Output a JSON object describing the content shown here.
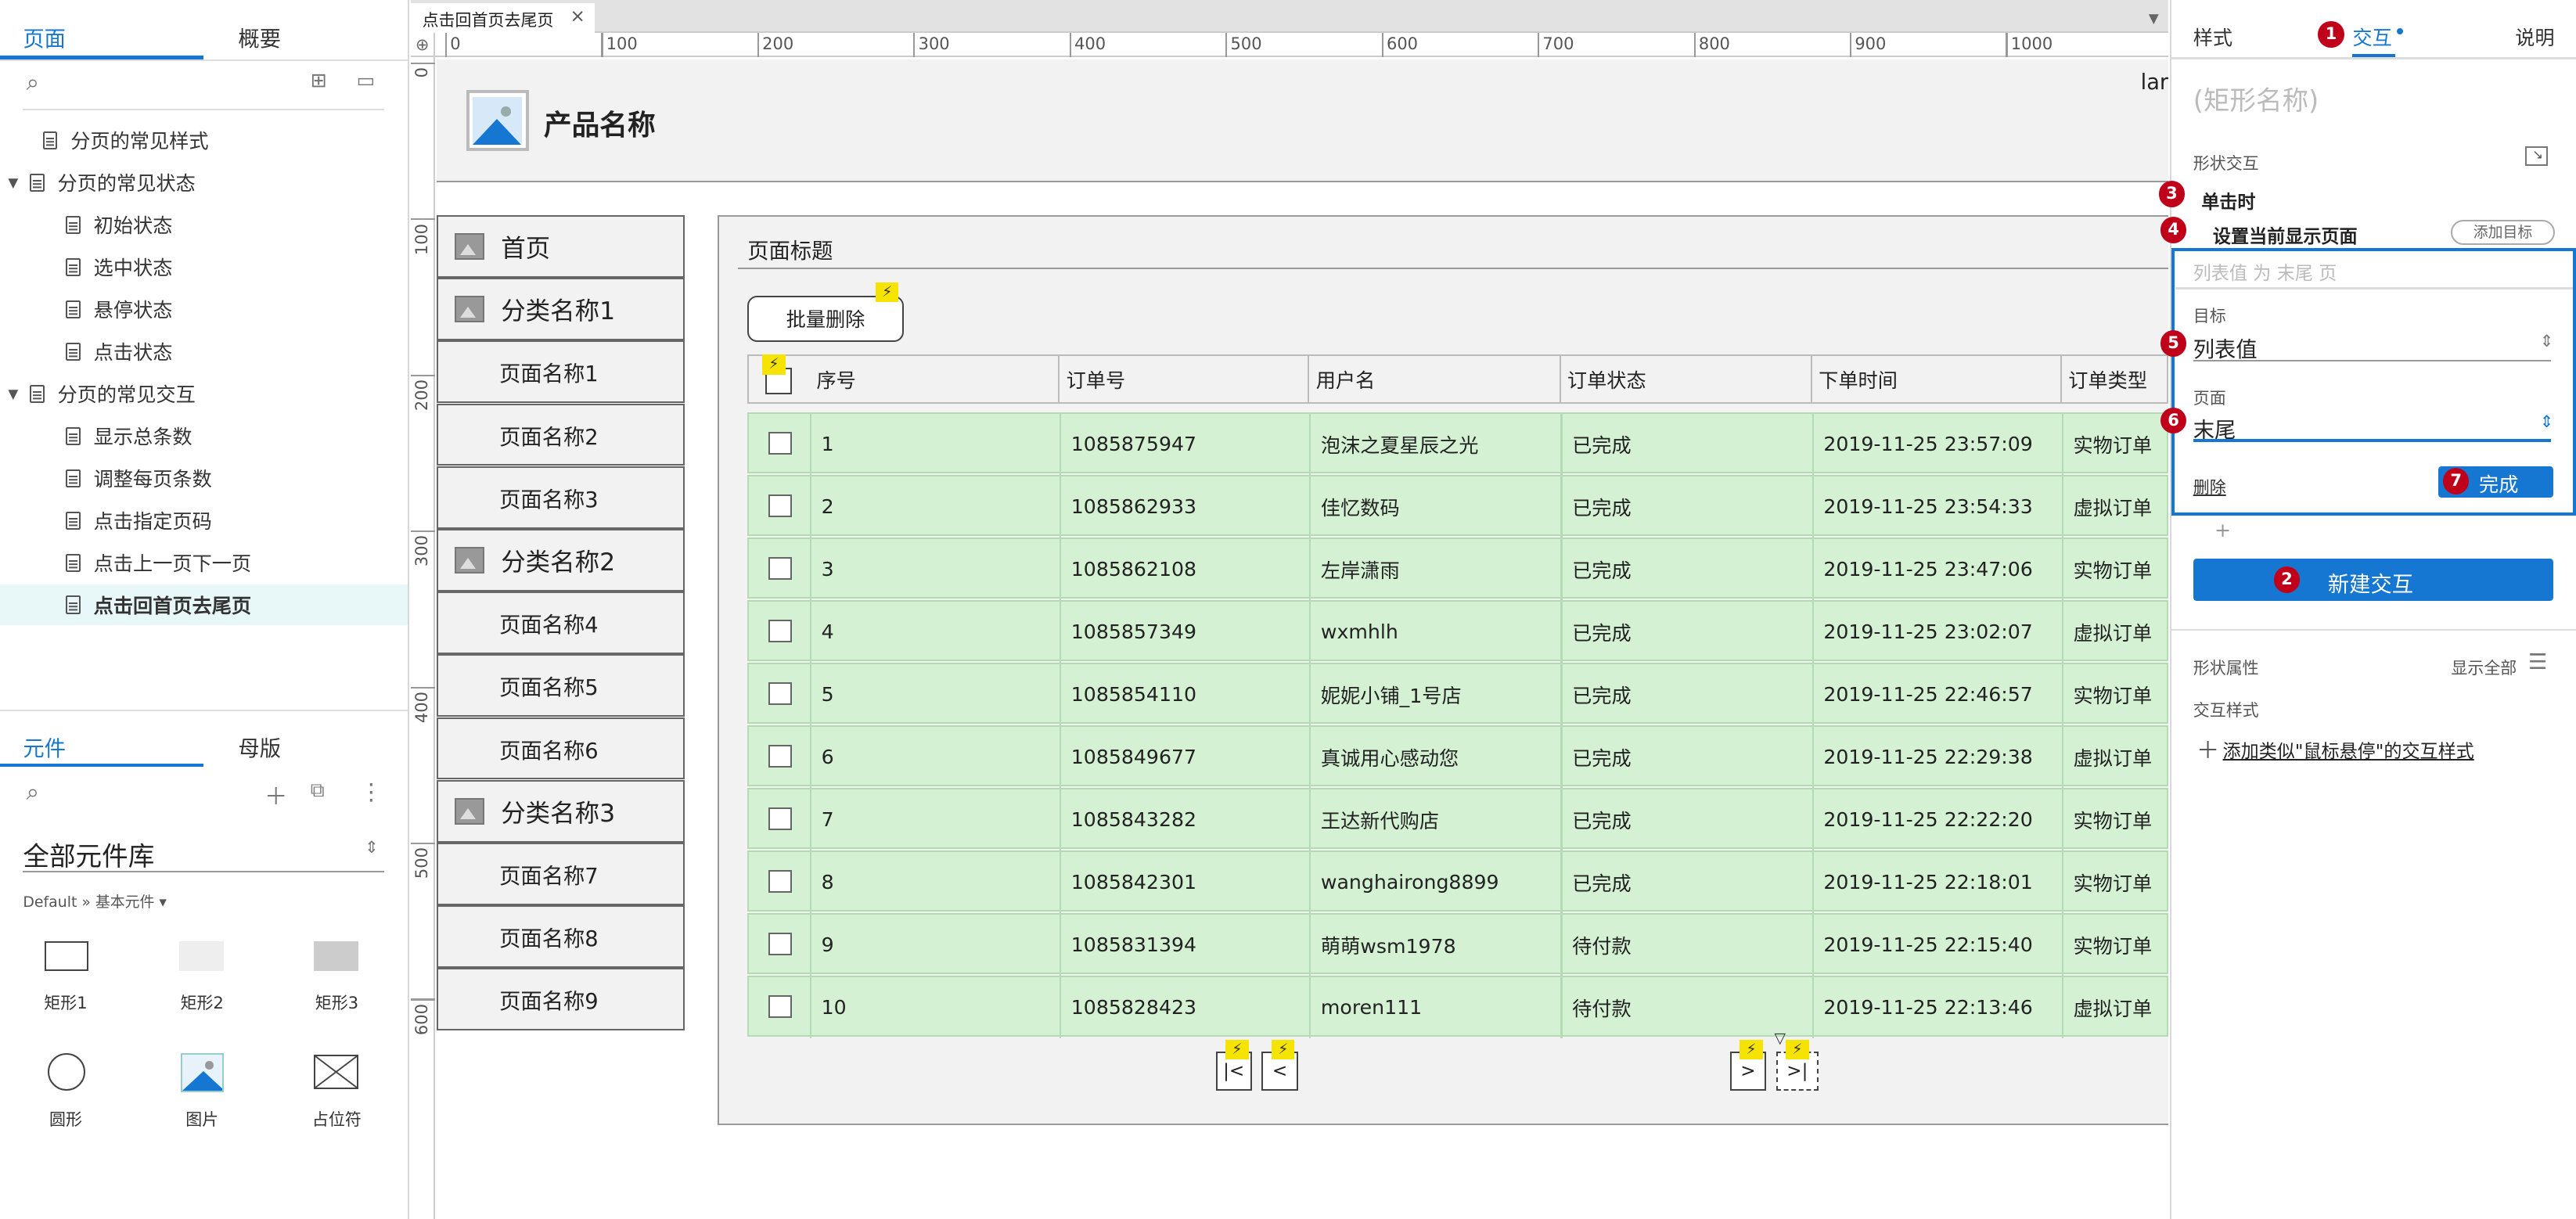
{
  "left_panel": {
    "tabs": [
      "页面",
      "概要"
    ],
    "tree": [
      {
        "label": "分页的常见样式",
        "level": 1,
        "expandable": false
      },
      {
        "label": "分页的常见状态",
        "level": 1,
        "expandable": true
      },
      {
        "label": "初始状态",
        "level": 2
      },
      {
        "label": "选中状态",
        "level": 2
      },
      {
        "label": "悬停状态",
        "level": 2
      },
      {
        "label": "点击状态",
        "level": 2
      },
      {
        "label": "分页的常见交互",
        "level": 1,
        "expandable": true
      },
      {
        "label": "显示总条数",
        "level": 2
      },
      {
        "label": "调整每页条数",
        "level": 2
      },
      {
        "label": "点击指定页码",
        "level": 2
      },
      {
        "label": "点击上一页下一页",
        "level": 2
      },
      {
        "label": "点击回首页去尾页",
        "level": 2,
        "selected": true
      }
    ],
    "lib_tabs": [
      "元件",
      "母版"
    ],
    "library_title": "全部元件库",
    "library_source": "Default » 基本元件 ▾",
    "widgets": [
      "矩形1",
      "矩形2",
      "矩形3",
      "圆形",
      "图片",
      "占位符"
    ]
  },
  "canvas": {
    "tab_title": "点击回首页去尾页",
    "ruler_top": [
      "0",
      "100",
      "200",
      "300",
      "400",
      "500",
      "600",
      "700",
      "800",
      "900",
      "1000"
    ],
    "ruler_left": [
      "0",
      "100",
      "200",
      "300",
      "400",
      "500",
      "600"
    ],
    "product_name": "产品名称",
    "truncated_text": "lar",
    "nav": [
      {
        "label": "首页",
        "type": "cat"
      },
      {
        "label": "分类名称1",
        "type": "cat"
      },
      {
        "label": "页面名称1",
        "type": "page"
      },
      {
        "label": "页面名称2",
        "type": "page"
      },
      {
        "label": "页面名称3",
        "type": "page"
      },
      {
        "label": "分类名称2",
        "type": "cat"
      },
      {
        "label": "页面名称4",
        "type": "page"
      },
      {
        "label": "页面名称5",
        "type": "page"
      },
      {
        "label": "页面名称6",
        "type": "page"
      },
      {
        "label": "分类名称3",
        "type": "cat"
      },
      {
        "label": "页面名称7",
        "type": "page"
      },
      {
        "label": "页面名称8",
        "type": "page"
      },
      {
        "label": "页面名称9",
        "type": "page"
      }
    ],
    "page_title": "页面标题",
    "batch_delete": "批量删除",
    "columns": [
      "序号",
      "订单号",
      "用户名",
      "订单状态",
      "下单时间",
      "订单类型"
    ],
    "rows": [
      [
        "1",
        "1085875947",
        "泡沫之夏星辰之光",
        "已完成",
        "2019-11-25 23:57:09",
        "实物订单"
      ],
      [
        "2",
        "1085862933",
        "佳忆数码",
        "已完成",
        "2019-11-25 23:54:33",
        "虚拟订单"
      ],
      [
        "3",
        "1085862108",
        "左岸潇雨",
        "已完成",
        "2019-11-25 23:47:06",
        "实物订单"
      ],
      [
        "4",
        "1085857349",
        "wxmhlh",
        "已完成",
        "2019-11-25 23:02:07",
        "虚拟订单"
      ],
      [
        "5",
        "1085854110",
        "妮妮小铺_1号店",
        "已完成",
        "2019-11-25 22:46:57",
        "实物订单"
      ],
      [
        "6",
        "1085849677",
        "真诚用心感动您",
        "已完成",
        "2019-11-25 22:29:38",
        "虚拟订单"
      ],
      [
        "7",
        "1085843282",
        "王达新代购店",
        "已完成",
        "2019-11-25 22:22:20",
        "实物订单"
      ],
      [
        "8",
        "1085842301",
        "wanghairong8899",
        "已完成",
        "2019-11-25 22:18:01",
        "实物订单"
      ],
      [
        "9",
        "1085831394",
        "萌萌wsm1978",
        "待付款",
        "2019-11-25 22:15:40",
        "实物订单"
      ],
      [
        "10",
        "1085828423",
        "moren111",
        "待付款",
        "2019-11-25 22:13:46",
        "虚拟订单"
      ]
    ],
    "pager": {
      "first": "|<",
      "prev": "<",
      "next": ">",
      "last": ">|"
    },
    "bolt": "⚡"
  },
  "right_panel": {
    "tabs": [
      "样式",
      "交互",
      "说明"
    ],
    "shape_name_placeholder": "(矩形名称)",
    "shape_interaction": "形状交互",
    "event": "单击时",
    "action": "设置当前显示页面",
    "add_target": "添加目标",
    "summary": "列表值 为 末尾 页",
    "target_label": "目标",
    "target_value": "列表值",
    "page_label": "页面",
    "page_value": "末尾",
    "delete": "删除",
    "done": "完成",
    "plus": "+",
    "new_interaction": "新建交互",
    "shape_props": "形状属性",
    "show_all": "显示全部",
    "interaction_style": "交互样式",
    "add_hover_style": "添加类似\"鼠标悬停\"的交互样式",
    "badges": [
      "1",
      "2",
      "3",
      "4",
      "5",
      "6",
      "7"
    ]
  },
  "colors": {
    "accent": "#1677d2",
    "row_green": "#d4f1d4",
    "badge_red": "#c0001a",
    "bolt_yellow": "#f6e400"
  }
}
